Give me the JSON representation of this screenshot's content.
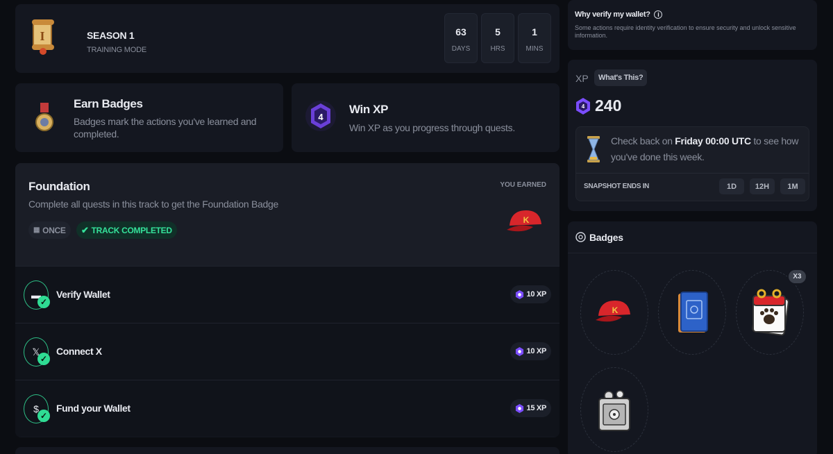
{
  "season": {
    "title": "SEASON 1",
    "mode": "TRAINING MODE",
    "icon": "scroll-icon",
    "countdown": [
      {
        "value": "63",
        "unit": "DAYS"
      },
      {
        "value": "5",
        "unit": "HRS"
      },
      {
        "value": "1",
        "unit": "MINS"
      }
    ]
  },
  "earn_badges": {
    "title": "Earn Badges",
    "desc": "Badges mark the actions you've learned and completed.",
    "icon": "medal-icon"
  },
  "win_xp": {
    "title": "Win XP",
    "desc": "Win XP as you progress through quests.",
    "icon": "xp-gem-icon"
  },
  "foundation": {
    "title": "Foundation",
    "desc": "Complete all quests in this track to get the Foundation Badge",
    "once_label": "ONCE",
    "status_label": "TRACK COMPLETED",
    "earned_label": "YOU EARNED",
    "reward_icon": "red-cap-icon",
    "quests": [
      {
        "name": "Verify Wallet",
        "xp": "10 XP",
        "icon": "wallet-icon",
        "symbol": "▬"
      },
      {
        "name": "Connect X",
        "xp": "10 XP",
        "icon": "x-logo-icon",
        "symbol": "𝕏"
      },
      {
        "name": "Fund your Wallet",
        "xp": "15 XP",
        "icon": "dollar-icon",
        "symbol": "$"
      }
    ]
  },
  "verify": {
    "title": "Why verify my wallet?",
    "desc": "Some actions require identity verification to ensure security and unlock sensitive information."
  },
  "xp": {
    "label": "XP",
    "whats_this": "What's This?",
    "value": "240",
    "check_prefix": "Check back on ",
    "check_time": "Friday 00:00 UTC",
    "check_suffix": " to see how you've done this week.",
    "snapshot_label": "SNAPSHOT ENDS IN",
    "ranges": [
      "1D",
      "12H",
      "1M"
    ]
  },
  "badges": {
    "title": "Badges",
    "items": [
      {
        "icon": "red-cap-badge-icon"
      },
      {
        "icon": "blue-book-badge-icon"
      },
      {
        "icon": "paw-calendar-badge-icon",
        "count": "X3"
      },
      {
        "icon": "safe-badge-icon"
      }
    ]
  },
  "colors": {
    "accent_green": "#35e19a",
    "accent_purple": "#7b4dff",
    "bg": "#0b0d12",
    "card": "#141720"
  }
}
